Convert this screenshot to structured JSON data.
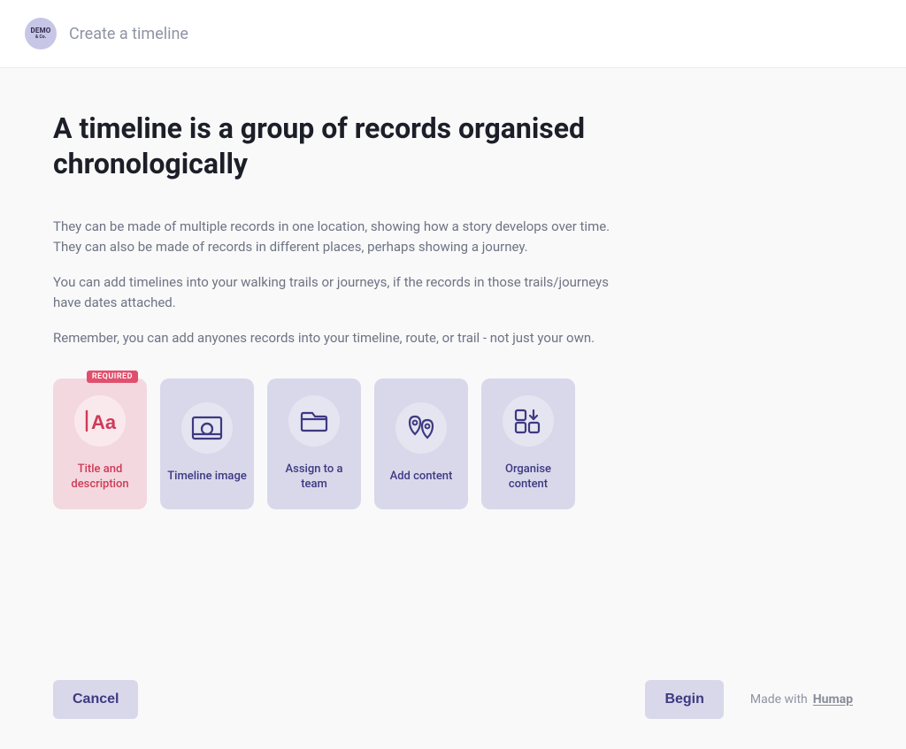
{
  "header": {
    "logo_top": "DEMO",
    "logo_bottom": "& Co.",
    "title": "Create a timeline"
  },
  "main": {
    "heading": "A timeline is a group of records organised chronologically",
    "paragraphs": [
      "They can be made of multiple records in one location, showing how a story develops over time. They can also be made of records in different places, perhaps showing a journey.",
      "You can add timelines into your walking trails or journeys, if the records in those trails/journeys have dates attached.",
      "Remember, you can add anyones records into your timeline, route, or trail - not just your own."
    ]
  },
  "cards": [
    {
      "label": "Title and description",
      "required": true,
      "required_badge": "REQUIRED",
      "icon": "text"
    },
    {
      "label": "Timeline image",
      "required": false,
      "icon": "image"
    },
    {
      "label": "Assign to a team",
      "required": false,
      "icon": "folder"
    },
    {
      "label": "Add content",
      "required": false,
      "icon": "pin"
    },
    {
      "label": "Organise content",
      "required": false,
      "icon": "layout"
    }
  ],
  "footer": {
    "cancel": "Cancel",
    "begin": "Begin",
    "made_with": "Made with",
    "brand": "Humap"
  },
  "colors": {
    "card_bg": "#d8d8ea",
    "card_required_bg": "#f4d8df",
    "accent_purple": "#3e3982",
    "accent_red": "#cf3a58",
    "badge_bg": "#e0506e"
  }
}
